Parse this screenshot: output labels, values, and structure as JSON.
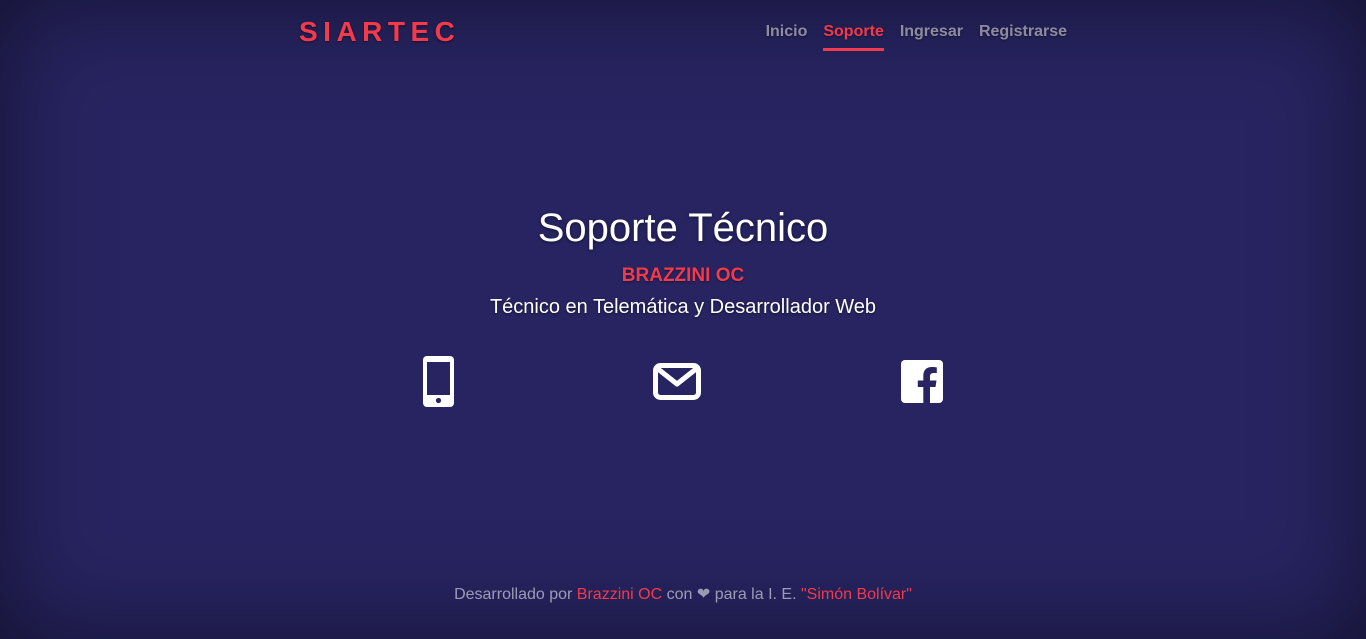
{
  "header": {
    "brand": "SIARTEC",
    "nav": [
      {
        "label": "Inicio"
      },
      {
        "label": "Soporte"
      },
      {
        "label": "Ingresar"
      },
      {
        "label": "Registrarse"
      }
    ]
  },
  "hero": {
    "title": "Soporte Técnico",
    "author": "BRAZZINI OC",
    "role": "Técnico en Telemática y Desarrollador Web",
    "icons": [
      "mobile-phone-icon",
      "envelope-icon",
      "facebook-icon"
    ]
  },
  "footer": {
    "prefix": "Desarrollado por",
    "author_link": "Brazzini OC",
    "middle": "con ❤ para la I. E.",
    "school_link": "\"Simón Bolívar\""
  },
  "colors": {
    "background": "#272461",
    "accent": "#f23a4c",
    "text": "#ffffff"
  }
}
